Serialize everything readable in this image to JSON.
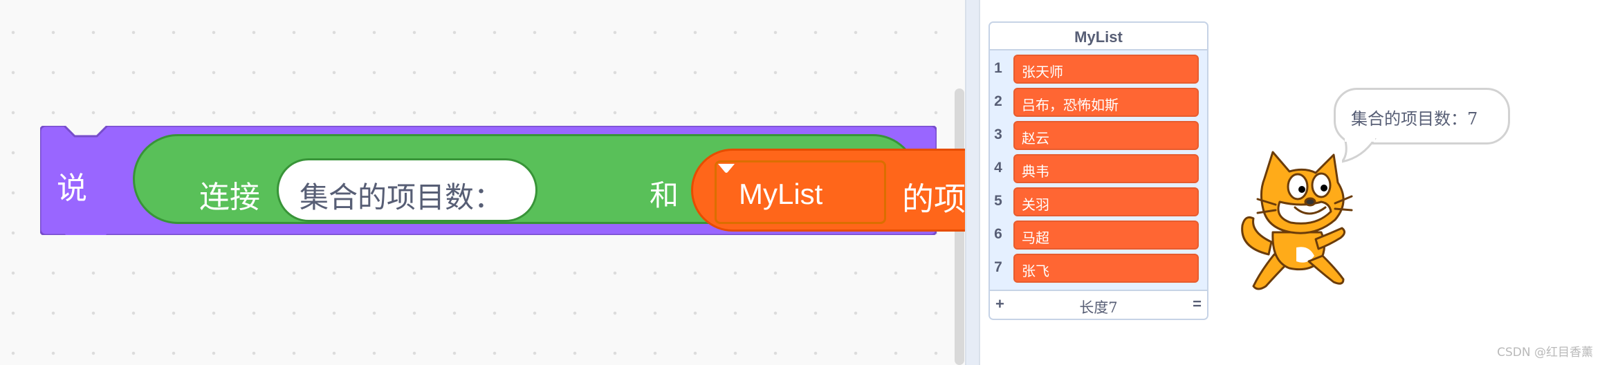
{
  "script": {
    "say_label": "说",
    "join_label": "连接",
    "join_input_value": "集合的项目数：",
    "and_label": "和",
    "list_name": "MyList",
    "length_label": "的项目数"
  },
  "stage": {
    "list_monitor": {
      "title": "MyList",
      "items": [
        {
          "index": "1",
          "value": "张天师"
        },
        {
          "index": "2",
          "value": "吕布，恐怖如斯"
        },
        {
          "index": "3",
          "value": "赵云"
        },
        {
          "index": "4",
          "value": "典韦"
        },
        {
          "index": "5",
          "value": "关羽"
        },
        {
          "index": "6",
          "value": "马超"
        },
        {
          "index": "7",
          "value": "张飞"
        }
      ],
      "add_label": "+",
      "length_text": "长度7",
      "resize_label": "="
    },
    "speech_bubble": "集合的项目数：7",
    "sprite_icon": "scratch-cat"
  },
  "watermark": "CSDN @红目香薰",
  "colors": {
    "looks_block": "#9966ff",
    "operator_block": "#59c059",
    "list_block": "#ff661a",
    "list_item": "#ff6633"
  }
}
